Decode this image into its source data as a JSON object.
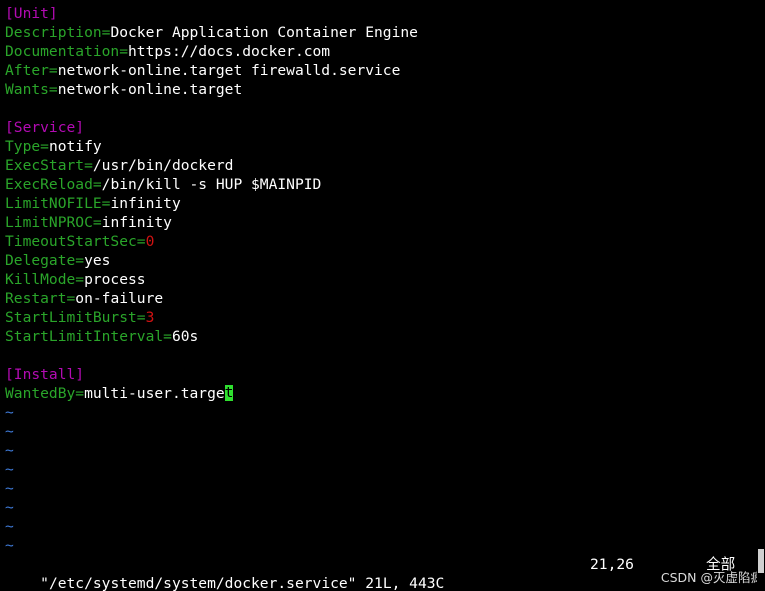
{
  "colors": {
    "background": "#000000",
    "text": "#ffffff",
    "section": "#b30bb3",
    "key": "#2aa52a",
    "number": "#d11212",
    "tilde": "#3e79d6",
    "cursor_bg": "#2fe02f",
    "cursor_fg": "#000000"
  },
  "editor": {
    "lines": [
      {
        "section": "[Unit]"
      },
      {
        "key": "Description=",
        "value": "Docker Application Container Engine"
      },
      {
        "key": "Documentation=",
        "value": "https://docs.docker.com"
      },
      {
        "key": "After=",
        "value": "network-online.target firewalld.service"
      },
      {
        "key": "Wants=",
        "value": "network-online.target"
      },
      {
        "blank": true
      },
      {
        "section": "[Service]"
      },
      {
        "key": "Type=",
        "value": "notify"
      },
      {
        "key": "ExecStart=",
        "value": "/usr/bin/dockerd"
      },
      {
        "key": "ExecReload=",
        "value": "/bin/kill -s HUP $MAINPID"
      },
      {
        "key": "LimitNOFILE=",
        "value": "infinity"
      },
      {
        "key": "LimitNPROC=",
        "value": "infinity"
      },
      {
        "key": "TimeoutStartSec=",
        "num": "0"
      },
      {
        "key": "Delegate=",
        "value": "yes"
      },
      {
        "key": "KillMode=",
        "value": "process"
      },
      {
        "key": "Restart=",
        "value": "on-failure"
      },
      {
        "key": "StartLimitBurst=",
        "num": "3"
      },
      {
        "key": "StartLimitInterval=",
        "value": "60s"
      },
      {
        "blank": true
      },
      {
        "section": "[Install]"
      },
      {
        "key": "WantedBy=",
        "value": "multi-user.targe",
        "cursor": "t"
      },
      {
        "tilde": "~"
      },
      {
        "tilde": "~"
      },
      {
        "tilde": "~"
      },
      {
        "tilde": "~"
      },
      {
        "tilde": "~"
      },
      {
        "tilde": "~"
      },
      {
        "tilde": "~"
      },
      {
        "tilde": "~"
      }
    ]
  },
  "status": {
    "file_info": "\"/etc/systemd/system/docker.service\" 21L, 443C",
    "position": "21,26",
    "scroll": "全部"
  },
  "watermark": "CSDN @灭虚陷疯"
}
